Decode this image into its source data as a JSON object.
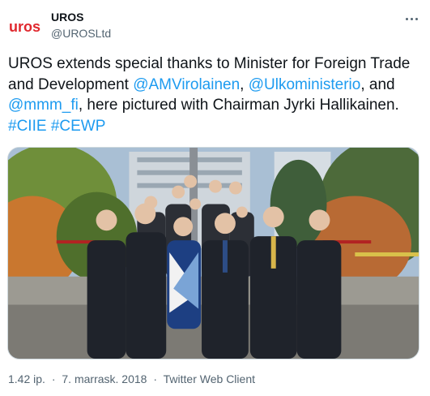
{
  "account": {
    "display_name": "UROS",
    "handle": "@UROSLtd",
    "avatar_logo_text": "uros",
    "brand_color": "#e0282e"
  },
  "tweet": {
    "text_parts": [
      {
        "type": "text",
        "value": "UROS extends special thanks to Minister for Foreign Trade and Development "
      },
      {
        "type": "link",
        "value": "@AMVirolainen"
      },
      {
        "type": "text",
        "value": ", "
      },
      {
        "type": "link",
        "value": "@Ulkoministerio"
      },
      {
        "type": "text",
        "value": ", and "
      },
      {
        "type": "link",
        "value": "@mmm_fi"
      },
      {
        "type": "text",
        "value": ", here pictured with Chairman Jyrki Hallikainen. "
      },
      {
        "type": "link",
        "value": "#CIIE"
      },
      {
        "type": "text",
        "value": " "
      },
      {
        "type": "link",
        "value": "#CEWP"
      }
    ],
    "link_color": "#1d9bf0",
    "photo_description_icon": "group-photo"
  },
  "footer": {
    "time": "1.42 ip.",
    "date": "7. marrask. 2018",
    "separator": "·",
    "client": "Twitter Web Client"
  },
  "icons": {
    "more": "more-options-icon"
  }
}
